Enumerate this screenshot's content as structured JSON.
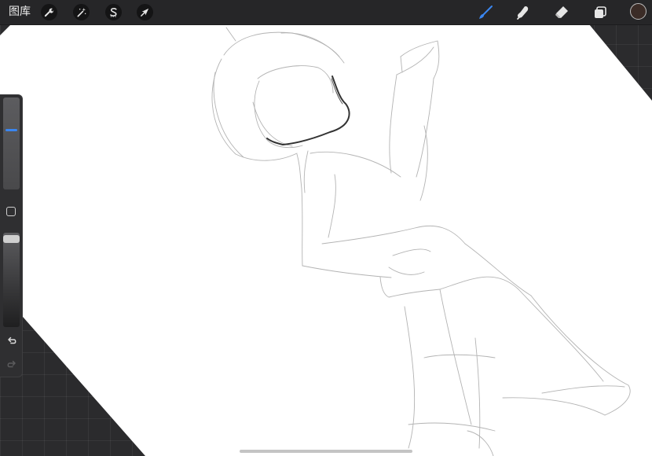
{
  "topbar": {
    "gallery_label": "图库",
    "left_tools": [
      {
        "name": "actions",
        "icon": "wrench-icon"
      },
      {
        "name": "adjustments",
        "icon": "magic-wand-icon"
      },
      {
        "name": "selection",
        "icon": "selection-s-icon"
      },
      {
        "name": "transform",
        "icon": "arrow-cursor-icon"
      }
    ],
    "right_tools": [
      {
        "name": "brush",
        "icon": "brush-icon",
        "active": true
      },
      {
        "name": "smudge",
        "icon": "smudge-finger-icon",
        "active": false
      },
      {
        "name": "eraser",
        "icon": "eraser-icon",
        "active": false
      },
      {
        "name": "layers",
        "icon": "layers-icon",
        "active": false
      }
    ],
    "current_color": "#3b2c27"
  },
  "sidebar": {
    "brush_size_level": 0.65,
    "opacity_level": 1.0,
    "buttons": [
      {
        "name": "modify",
        "icon": "square-icon"
      },
      {
        "name": "undo",
        "icon": "undo-icon"
      },
      {
        "name": "redo",
        "icon": "redo-icon"
      }
    ]
  },
  "colors": {
    "accent": "#3a86f0",
    "toolbar": "#262628",
    "canvas": "#ffffff",
    "backdrop": "#2b2b2d"
  }
}
